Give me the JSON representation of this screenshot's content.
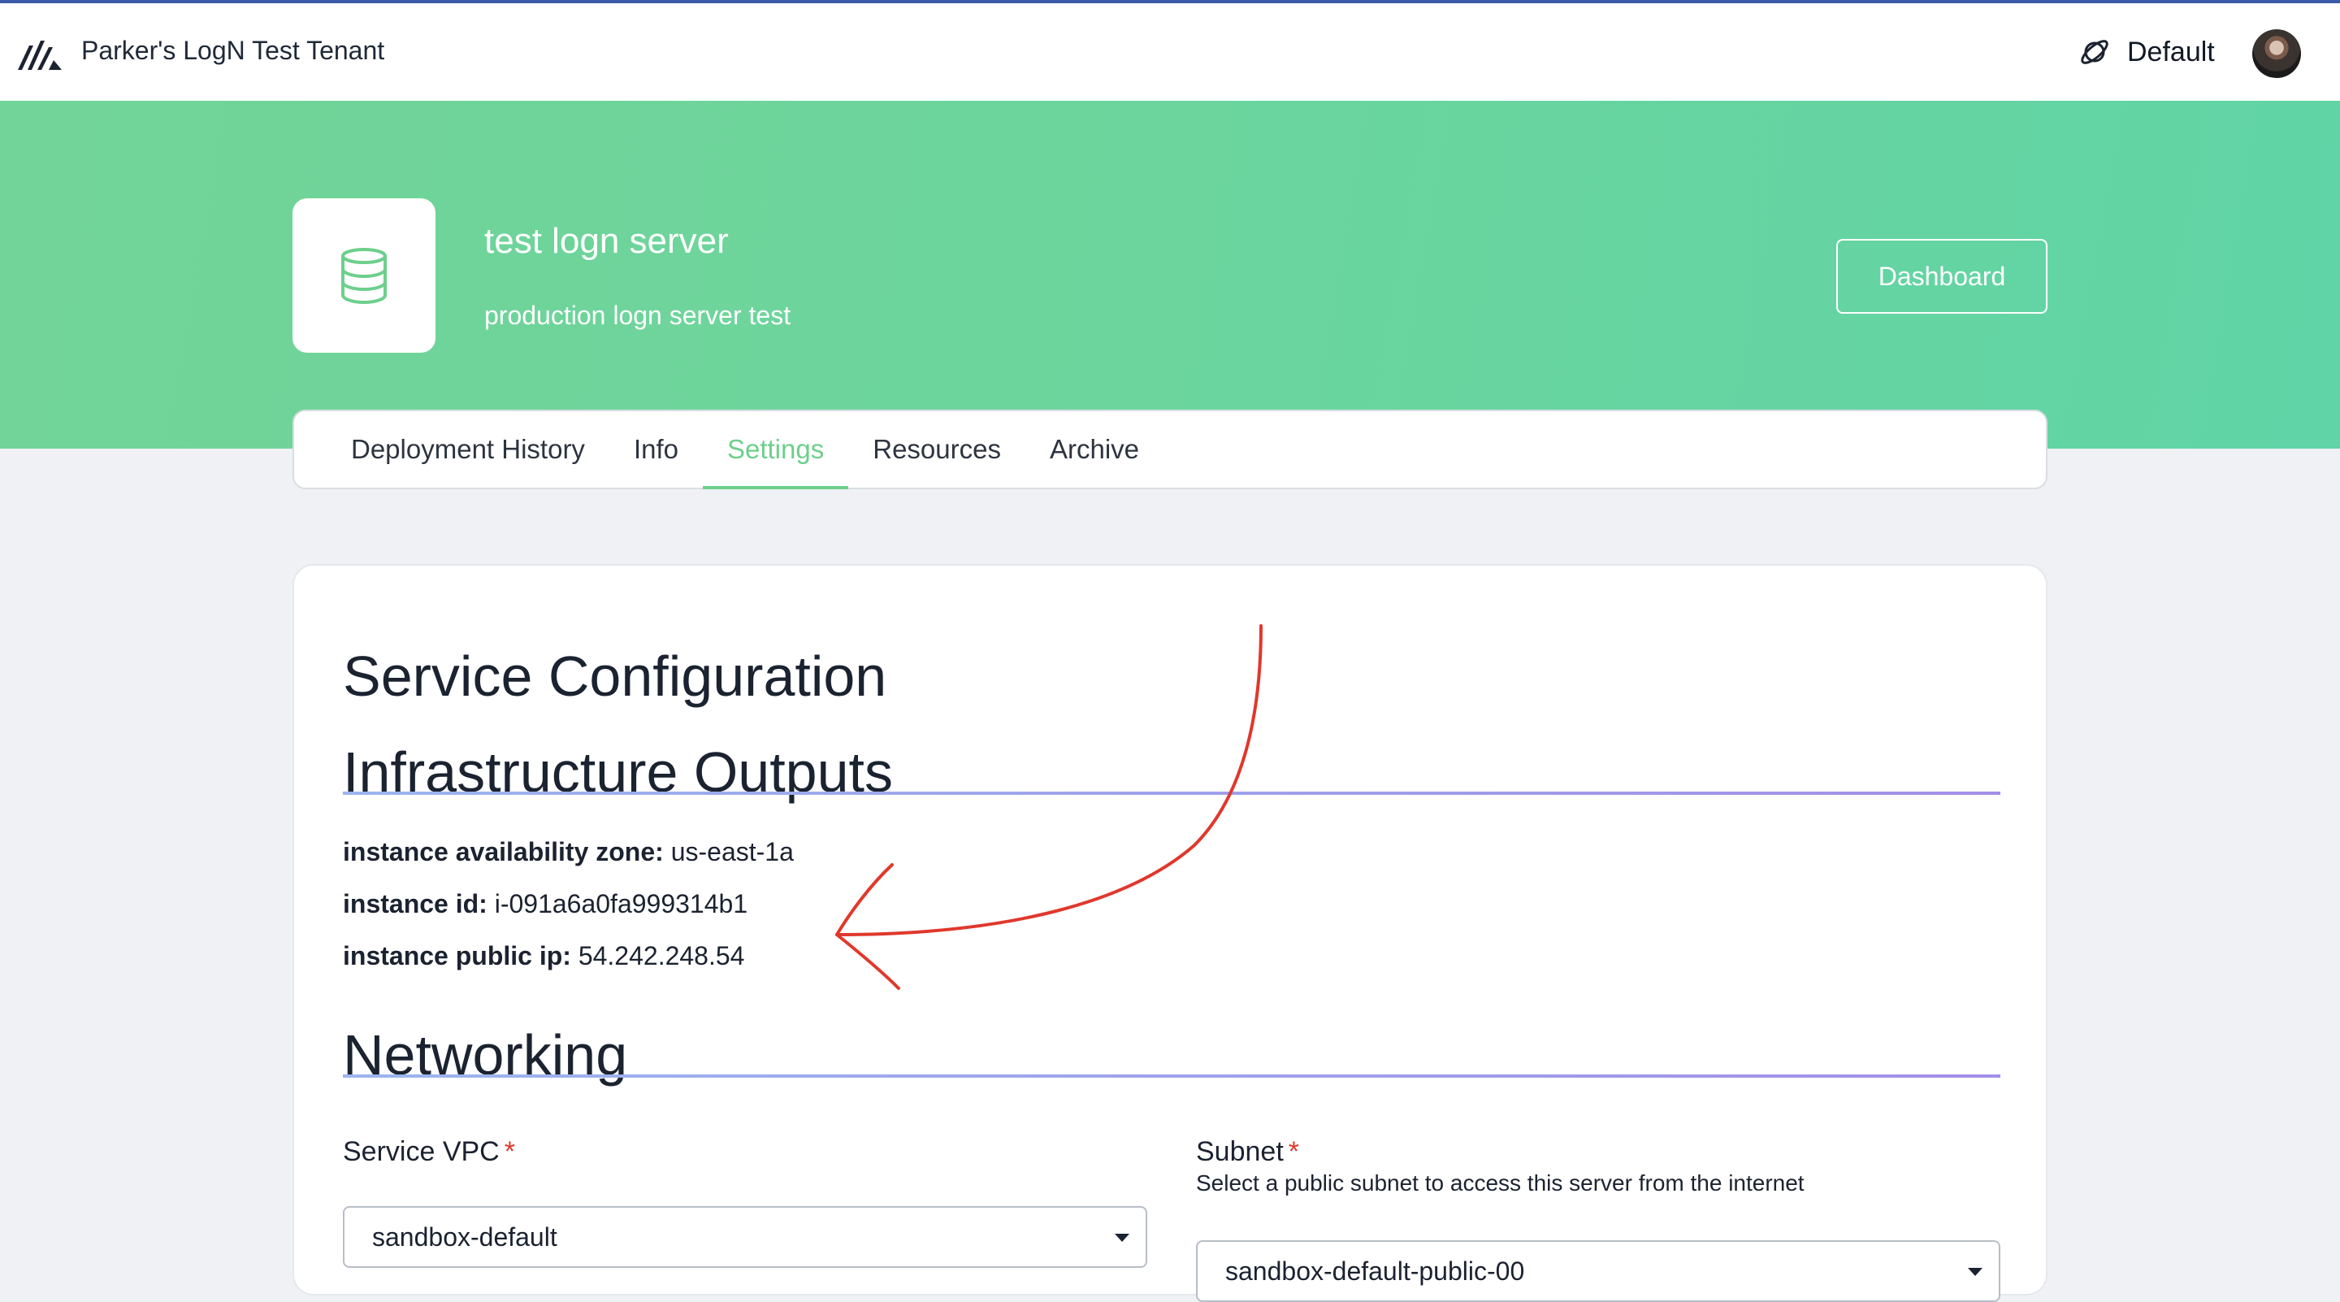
{
  "header": {
    "tenant_name": "Parker's LogN Test Tenant",
    "environment_label": "Default",
    "environment_icon": "planet-icon",
    "logo_icon": "brand-logo-icon"
  },
  "service": {
    "title": "test logn server",
    "description": "production logn server test",
    "icon": "database-icon",
    "dashboard_label": "Dashboard"
  },
  "tabs": [
    {
      "label": "Deployment History",
      "active": false
    },
    {
      "label": "Info",
      "active": false
    },
    {
      "label": "Settings",
      "active": true
    },
    {
      "label": "Resources",
      "active": false
    },
    {
      "label": "Archive",
      "active": false
    }
  ],
  "main": {
    "title": "Service Configuration",
    "outputs": {
      "heading": "Infrastructure Outputs",
      "items": [
        {
          "key": "instance availability zone:",
          "value": "us-east-1a"
        },
        {
          "key": "instance id:",
          "value": "i-091a6a0fa999314b1"
        },
        {
          "key": "instance public ip:",
          "value": "54.242.248.54"
        }
      ]
    },
    "networking": {
      "heading": "Networking",
      "vpc": {
        "label": "Service VPC",
        "required_mark": "*",
        "value": "sandbox-default"
      },
      "subnet": {
        "label": "Subnet",
        "required_mark": "*",
        "help": "Select a public subnet to access this server from the internet",
        "value": "sandbox-default-public-00"
      }
    }
  },
  "colors": {
    "accent_green": "#6dcf8c",
    "hero_gradient_start": "#72d498",
    "hero_gradient_end": "#60d4a6",
    "required_red": "#e0382c",
    "annotation_red": "#e0382c"
  }
}
